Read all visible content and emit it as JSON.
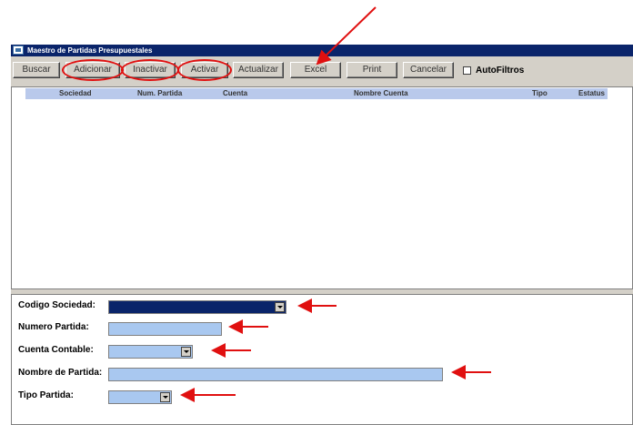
{
  "window": {
    "title": "Maestro de Partidas Presupuestales"
  },
  "toolbar": {
    "buttons": [
      {
        "label": "Buscar"
      },
      {
        "label": "Adicionar"
      },
      {
        "label": "Inactivar"
      },
      {
        "label": "Activar"
      },
      {
        "label": "Actualizar"
      },
      {
        "label": "Excel"
      },
      {
        "label": "Print"
      },
      {
        "label": "Cancelar"
      }
    ],
    "autofiltros": {
      "label": "AutoFiltros",
      "checked": false
    }
  },
  "grid": {
    "columns": [
      "Sociedad",
      "Num. Partida",
      "Cuenta",
      "Nombre Cuenta",
      "Tipo",
      "Estatus"
    ],
    "rows": []
  },
  "form": {
    "fields": [
      {
        "label": "Codigo Sociedad:",
        "value": ""
      },
      {
        "label": "Numero Partida:",
        "value": ""
      },
      {
        "label": "Cuenta Contable:",
        "value": ""
      },
      {
        "label": "Nombre de Partida:",
        "value": ""
      },
      {
        "label": "Tipo Partida:",
        "value": ""
      }
    ]
  },
  "annotations": {
    "highlight_color": "#e01010"
  }
}
